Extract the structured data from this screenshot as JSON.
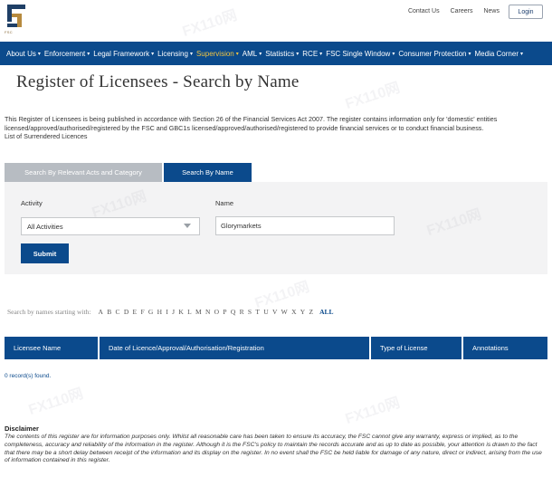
{
  "header": {
    "logo_text": "FSC",
    "top_links": [
      "Contact Us",
      "Careers",
      "News"
    ],
    "login_label": "Login"
  },
  "nav": {
    "items": [
      {
        "label": "About Us",
        "active": false
      },
      {
        "label": "Enforcement",
        "active": false
      },
      {
        "label": "Legal Framework",
        "active": false
      },
      {
        "label": "Licensing",
        "active": false
      },
      {
        "label": "Supervision",
        "active": true
      },
      {
        "label": "AML",
        "active": false
      },
      {
        "label": "Statistics",
        "active": false
      },
      {
        "label": "RCE",
        "active": false
      },
      {
        "label": "FSC Single Window",
        "active": false
      },
      {
        "label": "Consumer Protection",
        "active": false
      },
      {
        "label": "Media Corner",
        "active": false
      }
    ]
  },
  "page": {
    "title": "Register of Licensees - Search by Name",
    "intro": "This Register of Licensees is being published in accordance with Section 26 of the Financial Services Act 2007. The register contains information only for 'domestic' entities licensed/approved/authorised/registered by the FSC and GBC1s licensed/approved/authorised/registered to provide financial services or to conduct financial business.",
    "surrendered_link": "List of Surrendered Licences"
  },
  "tabs": {
    "relevant": "Search By Relevant Acts and Category",
    "by_name": "Search By Name"
  },
  "form": {
    "activity_label": "Activity",
    "activity_value": "All Activities",
    "name_label": "Name",
    "name_value": "Glorymarkets",
    "submit_label": "Submit"
  },
  "alphabet": {
    "prefix": "Search by names starting with:",
    "letters": [
      "A",
      "B",
      "C",
      "D",
      "E",
      "F",
      "G",
      "H",
      "I",
      "J",
      "K",
      "L",
      "M",
      "N",
      "O",
      "P",
      "Q",
      "R",
      "S",
      "T",
      "U",
      "V",
      "W",
      "X",
      "Y",
      "Z"
    ],
    "all_label": "ALL"
  },
  "table": {
    "headers": [
      "Licensee Name",
      "Date of Licence/Approval/Authorisation/Registration",
      "Type of License",
      "Annotations"
    ]
  },
  "results": {
    "count_text": "0 record(s) found."
  },
  "disclaimer": {
    "title": "Disclaimer",
    "text": "The contents of this register are for information purposes only. Whilst all reasonable care has been taken to ensure its accuracy, the FSC cannot give any warranty, express or implied, as to the completeness, accuracy and reliability of the information in the register. Although it is the FSC's policy to maintain the records accurate and as up to date as possible, your attention is drawn to the fact that there may be a short delay between receipt of the information and its display on the register. In no event shall the FSC be held liable for damage of any nature, direct or indirect, arising from the use of information contained in this register."
  },
  "watermark": {
    "text": "FX110网"
  },
  "colors": {
    "primary": "#0b4a8c",
    "accent": "#f1c542",
    "inactive_tab": "#b7bcc2",
    "panel_bg": "#f3f3f4"
  }
}
